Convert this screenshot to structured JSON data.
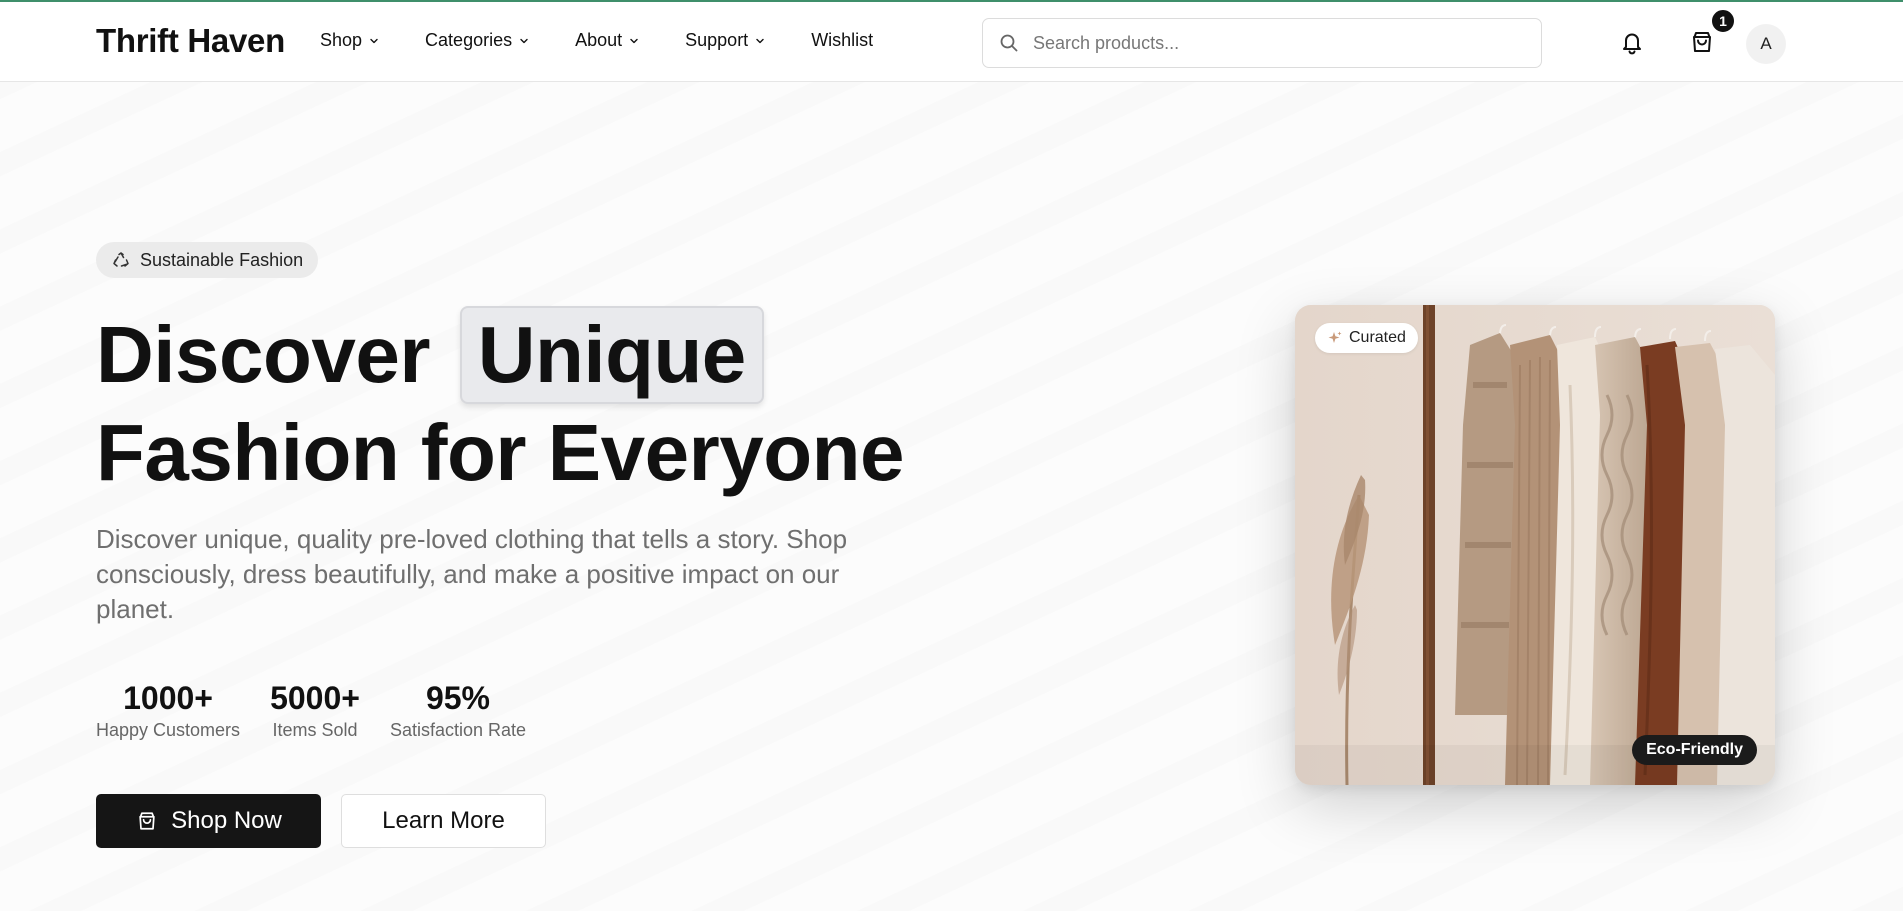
{
  "header": {
    "brand": "Thrift Haven",
    "nav": [
      {
        "label": "Shop",
        "has_dropdown": true
      },
      {
        "label": "Categories",
        "has_dropdown": true
      },
      {
        "label": "About",
        "has_dropdown": true
      },
      {
        "label": "Support",
        "has_dropdown": true
      },
      {
        "label": "Wishlist",
        "has_dropdown": false
      }
    ],
    "search": {
      "placeholder": "Search products...",
      "value": ""
    },
    "icons": [
      "bell-icon",
      "shopping-bag-icon"
    ],
    "cart_count": "1",
    "avatar_initial": "A",
    "accent_color": "#3f8f6b"
  },
  "hero": {
    "pill_label": "Sustainable Fashion",
    "pill_icon": "recycle-icon",
    "headline_part1": "Discover",
    "headline_highlight": "Unique",
    "headline_part2": "Fashion for Everyone",
    "description": "Discover unique, quality pre-loved clothing that tells a story. Shop consciously, dress beautifully, and make a positive impact on our planet.",
    "stats": [
      {
        "value": "1000+",
        "label": "Happy Customers"
      },
      {
        "value": "5000+",
        "label": "Items Sold"
      },
      {
        "value": "95%",
        "label": "Satisfaction Rate"
      }
    ],
    "primary_button": "Shop Now",
    "secondary_button": "Learn More"
  },
  "image_card": {
    "badge_top": "Curated",
    "badge_top_icon": "sparkles-icon",
    "badge_bottom": "Eco-Friendly",
    "image_description_icon": "clothing-rack-photo"
  }
}
